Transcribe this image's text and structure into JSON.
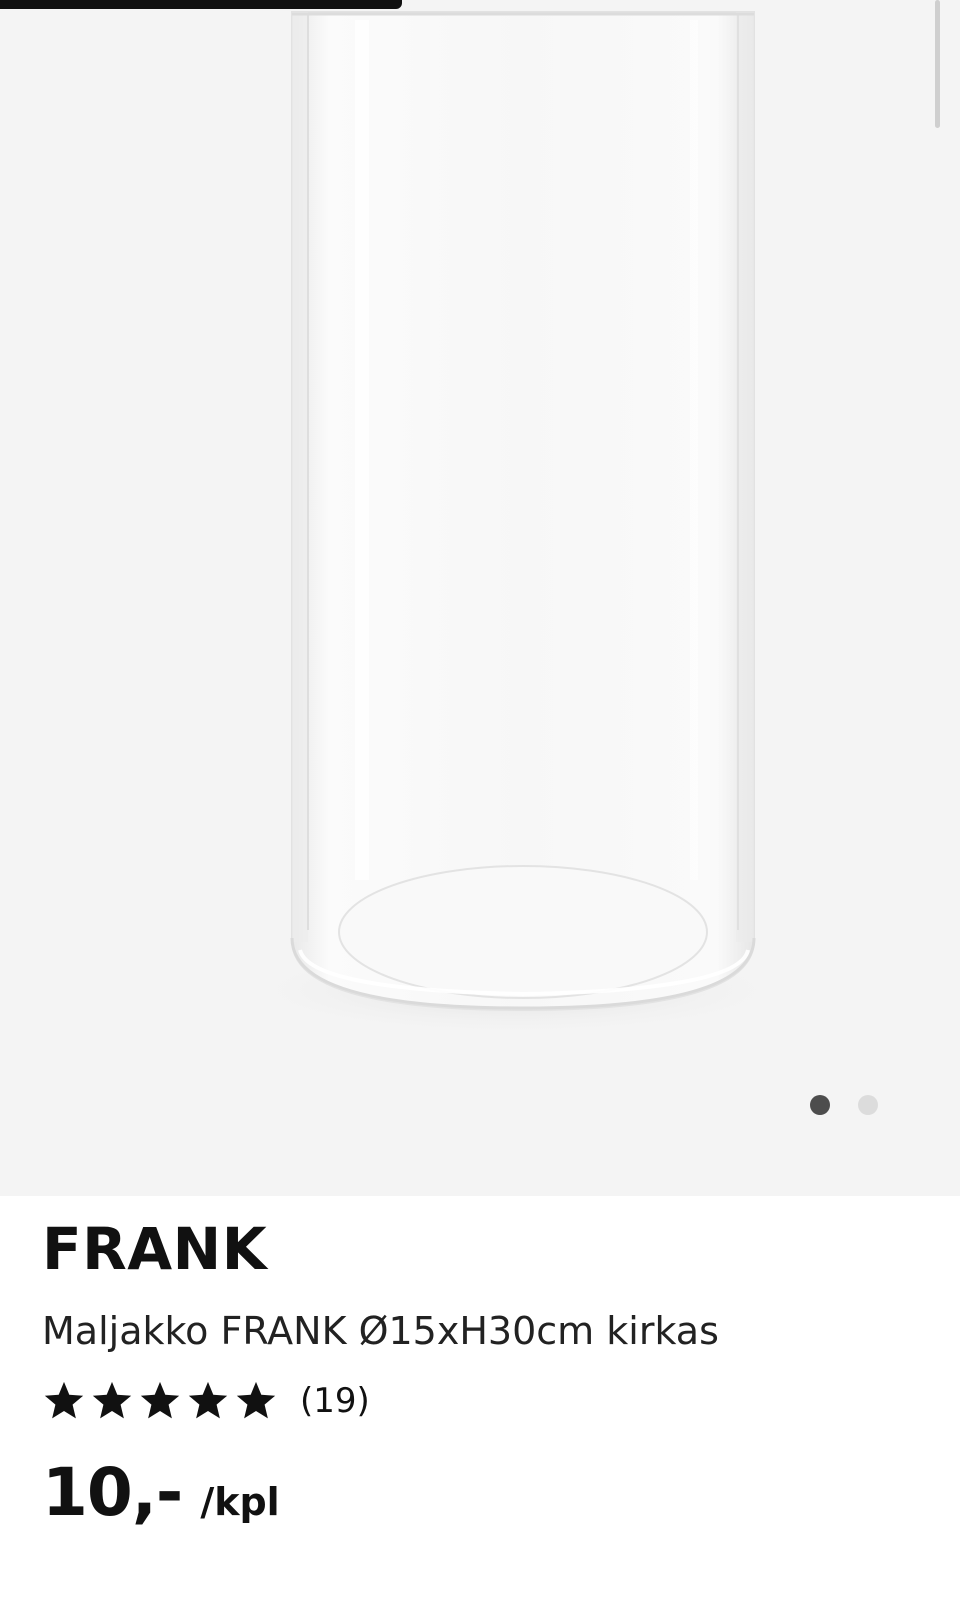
{
  "product": {
    "name": "FRANK",
    "description": "Maljakko FRANK Ø15xH30cm kirkas",
    "rating": {
      "stars": 5,
      "max_stars": 5,
      "review_count": "(19)"
    },
    "price": {
      "amount": "10,-",
      "unit": "/kpl"
    }
  },
  "gallery": {
    "image_count": 2,
    "active_index": 0,
    "icon": "glass-vase-photo"
  },
  "colors": {
    "image_background": "#f4f4f4",
    "page_background": "#ffffff",
    "text": "#111111",
    "dot_active": "#4d4d4d",
    "dot_inactive": "#dcdcdc"
  }
}
